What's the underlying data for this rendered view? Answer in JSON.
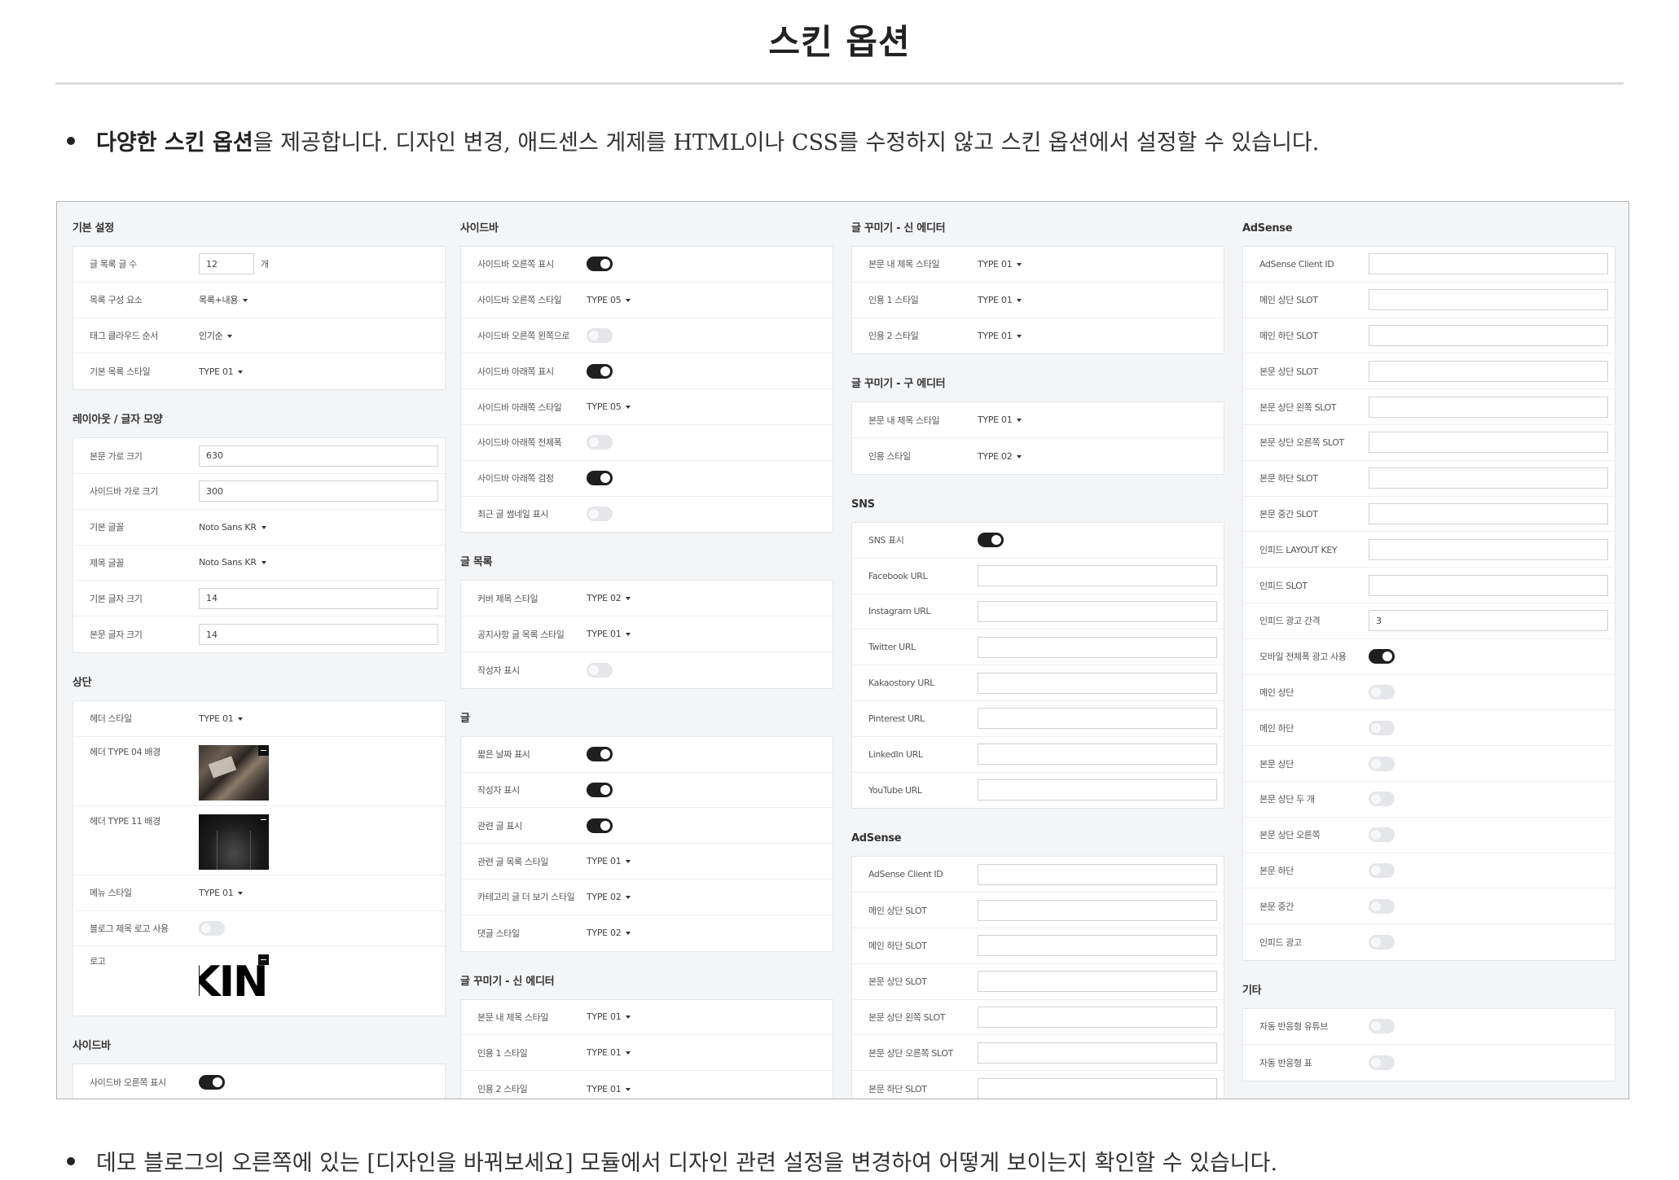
{
  "page": {
    "title": "스킨 옵션",
    "bullet1_bold": "다양한 스킨 옵션",
    "bullet1_rest": "을 제공합니다. 디자인 변경, 애드센스 게제를 HTML이나 CSS를 수정하지 않고 스킨 옵션에서 설정할 수 있습니다.",
    "bullet2": "데모 블로그의 오른쪽에 있는 [디자인을 바꿔보세요] 모듈에서 디자인 관련 설정을 변경하여 어떻게 보이는지 확인할 수 있습니다."
  },
  "screenshot": {
    "columns": [
      {
        "sections": [
          {
            "title": "기본 설정",
            "rows": [
              {
                "label": "글 목록 글 수",
                "type": "input-short",
                "value": "12",
                "unit": "개"
              },
              {
                "label": "목록 구성 요소",
                "type": "dropdown",
                "value": "목록+내용"
              },
              {
                "label": "태그 클라우드 순서",
                "type": "dropdown",
                "value": "인기순"
              },
              {
                "label": "기본 목록 스타일",
                "type": "dropdown",
                "value": "TYPE 01"
              }
            ]
          },
          {
            "title": "레이아웃 / 글자 모양",
            "rows": [
              {
                "label": "본문 가로 크기",
                "type": "input",
                "value": "630"
              },
              {
                "label": "사이드바 가로 크기",
                "type": "input",
                "value": "300"
              },
              {
                "label": "기본 글꼴",
                "type": "dropdown",
                "value": "Noto Sans KR"
              },
              {
                "label": "제목 글꼴",
                "type": "dropdown",
                "value": "Noto Sans KR"
              },
              {
                "label": "기본 글자 크기",
                "type": "input",
                "value": "14"
              },
              {
                "label": "본문 글자 크기",
                "type": "input",
                "value": "14"
              }
            ]
          },
          {
            "title": "상단",
            "rows": [
              {
                "label": "헤더 스타일",
                "type": "dropdown",
                "value": "TYPE 01"
              },
              {
                "label": "헤더 TYPE 04 배경",
                "type": "image",
                "image": "desk"
              },
              {
                "label": "헤더 TYPE 11 배경",
                "type": "image",
                "image": "hall"
              },
              {
                "label": "메뉴 스타일",
                "type": "dropdown",
                "value": "TYPE 01"
              },
              {
                "label": "블로그 제목 로고 사용",
                "type": "toggle",
                "on": false
              },
              {
                "label": "로고",
                "type": "image",
                "image": "logo",
                "value": "KIN"
              }
            ]
          },
          {
            "title": "사이드바",
            "rows": [
              {
                "label": "사이드바 오른쪽 표시",
                "type": "toggle",
                "on": true
              }
            ]
          }
        ]
      },
      {
        "sections": [
          {
            "title": "사이드바",
            "rows": [
              {
                "label": "사이드바 오른쪽 표시",
                "type": "toggle",
                "on": true
              },
              {
                "label": "사이드바 오른쪽 스타일",
                "type": "dropdown",
                "value": "TYPE 05"
              },
              {
                "label": "사이드바 오른쪽 왼쪽으로",
                "type": "toggle",
                "on": false
              },
              {
                "label": "사이드바 아래쪽 표시",
                "type": "toggle",
                "on": true
              },
              {
                "label": "사이드바 아래쪽 스타일",
                "type": "dropdown",
                "value": "TYPE 05"
              },
              {
                "label": "사이드바 아래쪽 전체폭",
                "type": "toggle",
                "on": false
              },
              {
                "label": "사이드바 아래쪽 검정",
                "type": "toggle",
                "on": true
              },
              {
                "label": "최근 글 썸네일 표시",
                "type": "toggle",
                "on": false
              }
            ]
          },
          {
            "title": "글 목록",
            "rows": [
              {
                "label": "커버 제목 스타일",
                "type": "dropdown",
                "value": "TYPE 02"
              },
              {
                "label": "공지사항 글 목록 스타일",
                "type": "dropdown",
                "value": "TYPE 01"
              },
              {
                "label": "작성자 표시",
                "type": "toggle",
                "on": false
              }
            ]
          },
          {
            "title": "글",
            "rows": [
              {
                "label": "짧은 날짜 표시",
                "type": "toggle",
                "on": true
              },
              {
                "label": "작성자 표시",
                "type": "toggle",
                "on": true
              },
              {
                "label": "관련 글 표시",
                "type": "toggle",
                "on": true
              },
              {
                "label": "관련 글 목록 스타일",
                "type": "dropdown",
                "value": "TYPE 01"
              },
              {
                "label": "카테고리 글 더 보기 스타일",
                "type": "dropdown",
                "value": "TYPE 02"
              },
              {
                "label": "댓글 스타일",
                "type": "dropdown",
                "value": "TYPE 02"
              }
            ]
          },
          {
            "title": "글 꾸미기 - 신 에디터",
            "rows": [
              {
                "label": "본문 내 제목 스타일",
                "type": "dropdown",
                "value": "TYPE 01"
              },
              {
                "label": "인용 1 스타일",
                "type": "dropdown",
                "value": "TYPE 01"
              },
              {
                "label": "인용 2 스타일",
                "type": "dropdown",
                "value": "TYPE 01"
              }
            ]
          }
        ]
      },
      {
        "sections": [
          {
            "title": "글 꾸미기 - 신 에디터",
            "rows": [
              {
                "label": "본문 내 제목 스타일",
                "type": "dropdown",
                "value": "TYPE 01"
              },
              {
                "label": "인용 1 스타일",
                "type": "dropdown",
                "value": "TYPE 01"
              },
              {
                "label": "인용 2 스타일",
                "type": "dropdown",
                "value": "TYPE 01"
              }
            ]
          },
          {
            "title": "글 꾸미기 - 구 에디터",
            "rows": [
              {
                "label": "본문 내 제목 스타일",
                "type": "dropdown",
                "value": "TYPE 01"
              },
              {
                "label": "인용 스타일",
                "type": "dropdown",
                "value": "TYPE 02"
              }
            ]
          },
          {
            "title": "SNS",
            "rows": [
              {
                "label": "SNS 표시",
                "type": "toggle",
                "on": true
              },
              {
                "label": "Facebook URL",
                "type": "input",
                "value": ""
              },
              {
                "label": "Instagram URL",
                "type": "input",
                "value": ""
              },
              {
                "label": "Twitter URL",
                "type": "input",
                "value": ""
              },
              {
                "label": "Kakaostory URL",
                "type": "input",
                "value": ""
              },
              {
                "label": "Pinterest URL",
                "type": "input",
                "value": ""
              },
              {
                "label": "LinkedIn URL",
                "type": "input",
                "value": ""
              },
              {
                "label": "YouTube URL",
                "type": "input",
                "value": ""
              }
            ]
          },
          {
            "title": "AdSense",
            "rows": [
              {
                "label": "AdSense Client ID",
                "type": "input",
                "value": ""
              },
              {
                "label": "메인 상단 SLOT",
                "type": "input",
                "value": ""
              },
              {
                "label": "메인 하단 SLOT",
                "type": "input",
                "value": ""
              },
              {
                "label": "본문 상단 SLOT",
                "type": "input",
                "value": ""
              },
              {
                "label": "본문 상단 왼쪽 SLOT",
                "type": "input",
                "value": ""
              },
              {
                "label": "본문 상단 오른쪽 SLOT",
                "type": "input",
                "value": ""
              },
              {
                "label": "본문 하단 SLOT",
                "type": "input",
                "value": ""
              }
            ]
          }
        ]
      },
      {
        "sections": [
          {
            "title": "AdSense",
            "rows": [
              {
                "label": "AdSense Client ID",
                "type": "input",
                "value": ""
              },
              {
                "label": "메인 상단 SLOT",
                "type": "input",
                "value": ""
              },
              {
                "label": "메인 하단 SLOT",
                "type": "input",
                "value": ""
              },
              {
                "label": "본문 상단 SLOT",
                "type": "input",
                "value": ""
              },
              {
                "label": "본문 상단 왼쪽 SLOT",
                "type": "input",
                "value": ""
              },
              {
                "label": "본문 상단 오른쪽 SLOT",
                "type": "input",
                "value": ""
              },
              {
                "label": "본문 하단 SLOT",
                "type": "input",
                "value": ""
              },
              {
                "label": "본문 중간 SLOT",
                "type": "input",
                "value": ""
              },
              {
                "label": "인피드 LAYOUT KEY",
                "type": "input",
                "value": ""
              },
              {
                "label": "인피드 SLOT",
                "type": "input",
                "value": ""
              },
              {
                "label": "인피드 광고 간격",
                "type": "input",
                "value": "3"
              },
              {
                "label": "모바일 전체폭 광고 사용",
                "type": "toggle",
                "on": true
              },
              {
                "label": "메인 상단",
                "type": "toggle",
                "on": false
              },
              {
                "label": "메인 하단",
                "type": "toggle",
                "on": false
              },
              {
                "label": "본문 상단",
                "type": "toggle",
                "on": false
              },
              {
                "label": "본문 상단 두 개",
                "type": "toggle",
                "on": false
              },
              {
                "label": "본문 상단 오른쪽",
                "type": "toggle",
                "on": false
              },
              {
                "label": "본문 하단",
                "type": "toggle",
                "on": false
              },
              {
                "label": "본문 중간",
                "type": "toggle",
                "on": false
              },
              {
                "label": "인피드 광고",
                "type": "toggle",
                "on": false
              }
            ]
          },
          {
            "title": "기타",
            "rows": [
              {
                "label": "자동 반응형 유튜브",
                "type": "toggle",
                "on": false
              },
              {
                "label": "자동 반응형 표",
                "type": "toggle",
                "on": false
              }
            ]
          }
        ]
      }
    ]
  }
}
